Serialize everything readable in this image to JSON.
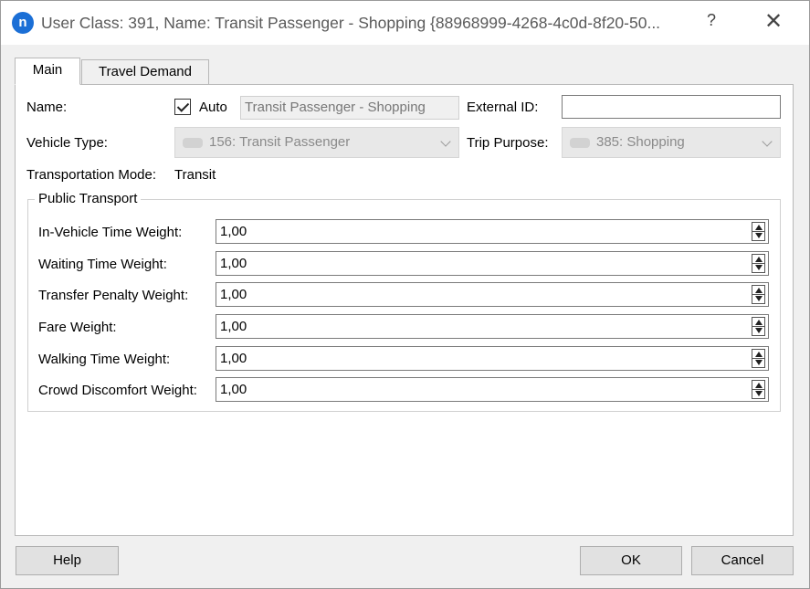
{
  "window": {
    "title": "User Class: 391, Name: Transit Passenger - Shopping  {88968999-4268-4c0d-8f20-50...",
    "app_icon_glyph": "n",
    "help_glyph": "?",
    "close_glyph": "✕",
    "accent": "#1b6fd6"
  },
  "tabs": [
    {
      "label": "Main",
      "active": true
    },
    {
      "label": "Travel Demand",
      "active": false
    }
  ],
  "form": {
    "name_label": "Name:",
    "auto_label": "Auto",
    "auto_checked": true,
    "name_value": "Transit Passenger - Shopping",
    "external_id_label": "External ID:",
    "external_id_value": "",
    "vehicle_type_label": "Vehicle Type:",
    "vehicle_type_value": "156: Transit Passenger",
    "trip_purpose_label": "Trip Purpose:",
    "trip_purpose_value": "385: Shopping",
    "mode_label": "Transportation Mode:",
    "mode_value": "Transit"
  },
  "public_transport": {
    "title": "Public Transport",
    "fields": [
      {
        "label": "In-Vehicle Time Weight:",
        "value": "1,00"
      },
      {
        "label": "Waiting Time Weight:",
        "value": "1,00"
      },
      {
        "label": "Transfer Penalty Weight:",
        "value": "1,00"
      },
      {
        "label": "Fare Weight:",
        "value": "1,00"
      },
      {
        "label": "Walking Time Weight:",
        "value": "1,00"
      },
      {
        "label": "Crowd Discomfort Weight:",
        "value": "1,00"
      }
    ]
  },
  "buttons": {
    "help": "Help",
    "ok": "OK",
    "cancel": "Cancel"
  }
}
